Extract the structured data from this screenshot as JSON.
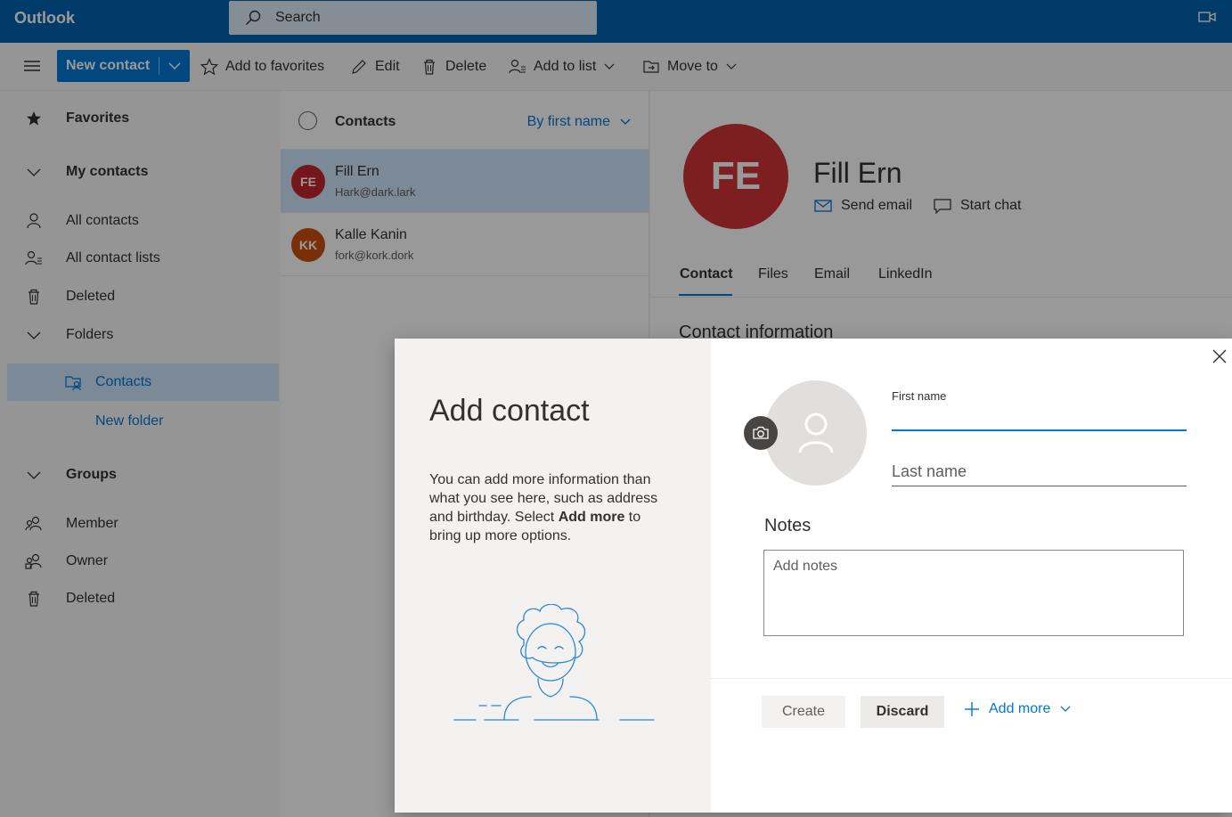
{
  "app": {
    "name": "Outlook"
  },
  "search": {
    "placeholder": "Search"
  },
  "toolbar": {
    "new_contact": "New contact",
    "add_to_favorites": "Add to favorites",
    "edit": "Edit",
    "delete": "Delete",
    "add_to_list": "Add to list",
    "move_to": "Move to"
  },
  "sidebar": {
    "favorites": "Favorites",
    "my_contacts": "My contacts",
    "all_contacts": "All contacts",
    "all_contact_lists": "All contact lists",
    "deleted": "Deleted",
    "folders": "Folders",
    "contacts": "Contacts",
    "new_folder": "New folder",
    "groups": "Groups",
    "member": "Member",
    "owner": "Owner",
    "groups_deleted": "Deleted"
  },
  "contact_list": {
    "title": "Contacts",
    "sort": "By first name",
    "items": [
      {
        "initials": "FE",
        "name": "Fill Ern",
        "email": "Hark@dark.lark",
        "color": "#c4262e",
        "selected": true
      },
      {
        "initials": "KK",
        "name": "Kalle Kanin",
        "email": "fork@kork.dork",
        "color": "#ca5010",
        "selected": false
      }
    ]
  },
  "detail": {
    "initials": "FE",
    "name": "Fill Ern",
    "send_email": "Send email",
    "start_chat": "Start chat",
    "tabs": [
      "Contact",
      "Files",
      "Email",
      "LinkedIn"
    ],
    "active_tab": "Contact",
    "section_title": "Contact information"
  },
  "dialog": {
    "title": "Add contact",
    "desc_part1": "You can add more information than what you see here, such as address and birthday. Select ",
    "desc_bold": "Add more",
    "desc_part2": " to bring up more options.",
    "first_name_label": "First name",
    "first_name_value": "",
    "last_name_placeholder": "Last name",
    "notes_label": "Notes",
    "notes_placeholder": "Add notes",
    "create": "Create",
    "discard": "Discard",
    "add_more": "Add more"
  },
  "colors": {
    "topbar": "#0063b1",
    "accent": "#0078d4",
    "selection": "#cfe4fa"
  }
}
